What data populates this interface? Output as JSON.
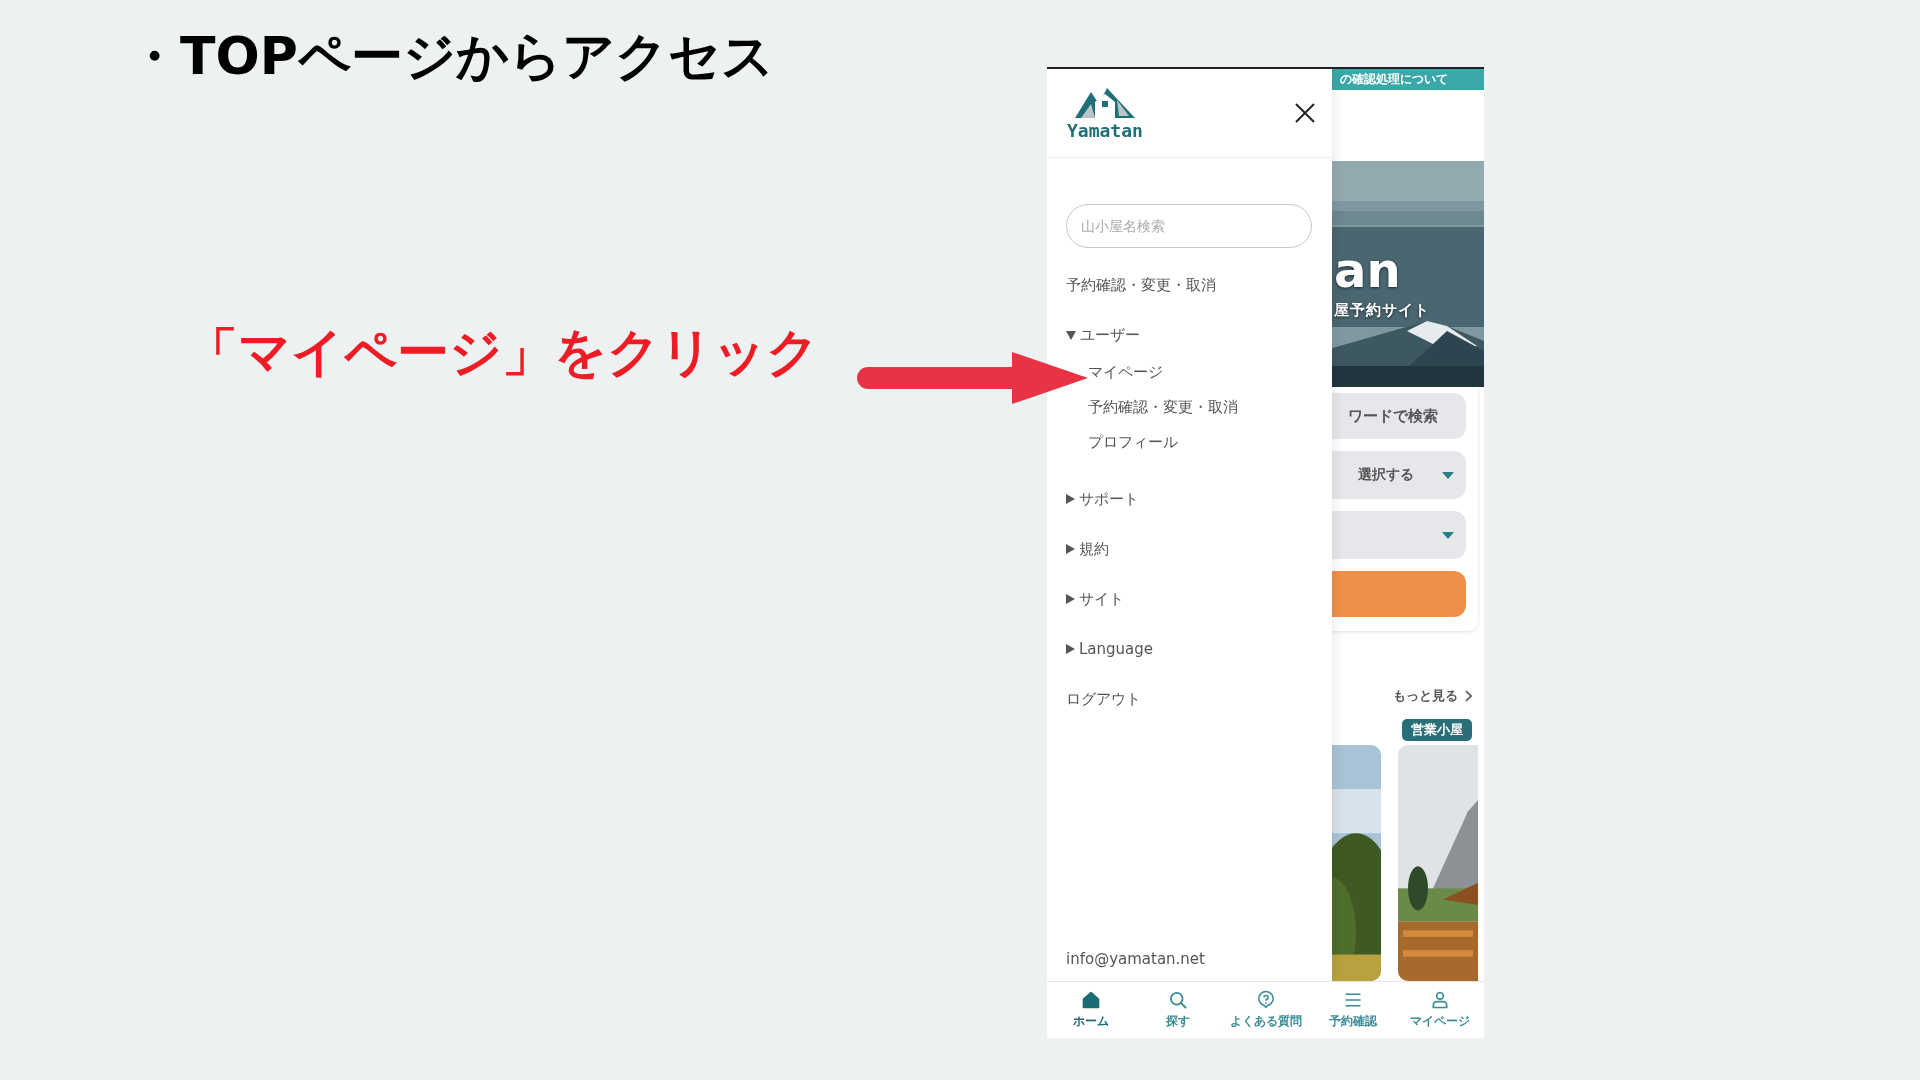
{
  "slide": {
    "title": "・TOPページからアクセス",
    "callout": "「マイページ」をクリック"
  },
  "drawer": {
    "logo": "Yamatan",
    "search": {
      "placeholder": "山小屋名検索"
    },
    "items": [
      {
        "kind": "link",
        "label": "予約確認・変更・取消"
      },
      {
        "kind": "group",
        "label": "ユーザー",
        "expanded": true,
        "children": [
          {
            "label": "マイページ"
          },
          {
            "label": "予約確認・変更・取消"
          },
          {
            "label": "プロフィール"
          }
        ]
      },
      {
        "kind": "group",
        "label": "サポート",
        "expanded": false
      },
      {
        "kind": "group",
        "label": "規約",
        "expanded": false
      },
      {
        "kind": "group",
        "label": "サイト",
        "expanded": false
      },
      {
        "kind": "group",
        "label": "Language",
        "expanded": false
      },
      {
        "kind": "link",
        "label": "ログアウト"
      }
    ],
    "email": "info@yamatan.net"
  },
  "page": {
    "banner": "の確認処理について",
    "hero_title": "an",
    "hero_subtitle": "屋予約サイト",
    "keyword_field": "ワードで検索",
    "select": "選択する",
    "more_link": "もっと見る",
    "badge": "営業小屋"
  },
  "bottom_nav": [
    {
      "kind": "home",
      "label": "ホーム",
      "selected": true
    },
    {
      "kind": "search",
      "label": "探す",
      "selected": false
    },
    {
      "kind": "faq",
      "label": "よくある質問",
      "selected": false
    },
    {
      "kind": "menu",
      "label": "予約確認",
      "selected": false
    },
    {
      "kind": "user",
      "label": "マイページ",
      "selected": false
    }
  ]
}
